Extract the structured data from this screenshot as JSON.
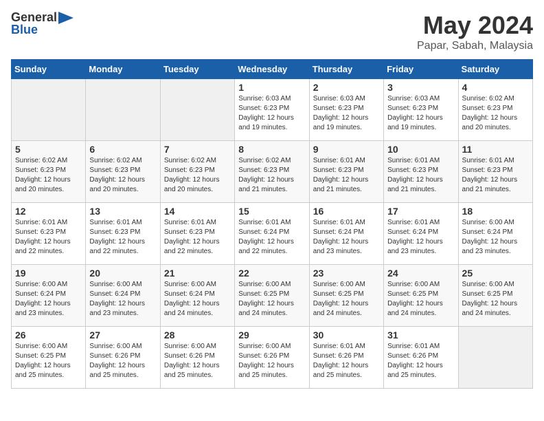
{
  "header": {
    "logo_general": "General",
    "logo_blue": "Blue",
    "month": "May 2024",
    "location": "Papar, Sabah, Malaysia"
  },
  "weekdays": [
    "Sunday",
    "Monday",
    "Tuesday",
    "Wednesday",
    "Thursday",
    "Friday",
    "Saturday"
  ],
  "weeks": [
    [
      {
        "day": "",
        "info": ""
      },
      {
        "day": "",
        "info": ""
      },
      {
        "day": "",
        "info": ""
      },
      {
        "day": "1",
        "info": "Sunrise: 6:03 AM\nSunset: 6:23 PM\nDaylight: 12 hours\nand 19 minutes."
      },
      {
        "day": "2",
        "info": "Sunrise: 6:03 AM\nSunset: 6:23 PM\nDaylight: 12 hours\nand 19 minutes."
      },
      {
        "day": "3",
        "info": "Sunrise: 6:03 AM\nSunset: 6:23 PM\nDaylight: 12 hours\nand 19 minutes."
      },
      {
        "day": "4",
        "info": "Sunrise: 6:02 AM\nSunset: 6:23 PM\nDaylight: 12 hours\nand 20 minutes."
      }
    ],
    [
      {
        "day": "5",
        "info": "Sunrise: 6:02 AM\nSunset: 6:23 PM\nDaylight: 12 hours\nand 20 minutes."
      },
      {
        "day": "6",
        "info": "Sunrise: 6:02 AM\nSunset: 6:23 PM\nDaylight: 12 hours\nand 20 minutes."
      },
      {
        "day": "7",
        "info": "Sunrise: 6:02 AM\nSunset: 6:23 PM\nDaylight: 12 hours\nand 20 minutes."
      },
      {
        "day": "8",
        "info": "Sunrise: 6:02 AM\nSunset: 6:23 PM\nDaylight: 12 hours\nand 21 minutes."
      },
      {
        "day": "9",
        "info": "Sunrise: 6:01 AM\nSunset: 6:23 PM\nDaylight: 12 hours\nand 21 minutes."
      },
      {
        "day": "10",
        "info": "Sunrise: 6:01 AM\nSunset: 6:23 PM\nDaylight: 12 hours\nand 21 minutes."
      },
      {
        "day": "11",
        "info": "Sunrise: 6:01 AM\nSunset: 6:23 PM\nDaylight: 12 hours\nand 21 minutes."
      }
    ],
    [
      {
        "day": "12",
        "info": "Sunrise: 6:01 AM\nSunset: 6:23 PM\nDaylight: 12 hours\nand 22 minutes."
      },
      {
        "day": "13",
        "info": "Sunrise: 6:01 AM\nSunset: 6:23 PM\nDaylight: 12 hours\nand 22 minutes."
      },
      {
        "day": "14",
        "info": "Sunrise: 6:01 AM\nSunset: 6:23 PM\nDaylight: 12 hours\nand 22 minutes."
      },
      {
        "day": "15",
        "info": "Sunrise: 6:01 AM\nSunset: 6:24 PM\nDaylight: 12 hours\nand 22 minutes."
      },
      {
        "day": "16",
        "info": "Sunrise: 6:01 AM\nSunset: 6:24 PM\nDaylight: 12 hours\nand 23 minutes."
      },
      {
        "day": "17",
        "info": "Sunrise: 6:01 AM\nSunset: 6:24 PM\nDaylight: 12 hours\nand 23 minutes."
      },
      {
        "day": "18",
        "info": "Sunrise: 6:00 AM\nSunset: 6:24 PM\nDaylight: 12 hours\nand 23 minutes."
      }
    ],
    [
      {
        "day": "19",
        "info": "Sunrise: 6:00 AM\nSunset: 6:24 PM\nDaylight: 12 hours\nand 23 minutes."
      },
      {
        "day": "20",
        "info": "Sunrise: 6:00 AM\nSunset: 6:24 PM\nDaylight: 12 hours\nand 23 minutes."
      },
      {
        "day": "21",
        "info": "Sunrise: 6:00 AM\nSunset: 6:24 PM\nDaylight: 12 hours\nand 24 minutes."
      },
      {
        "day": "22",
        "info": "Sunrise: 6:00 AM\nSunset: 6:25 PM\nDaylight: 12 hours\nand 24 minutes."
      },
      {
        "day": "23",
        "info": "Sunrise: 6:00 AM\nSunset: 6:25 PM\nDaylight: 12 hours\nand 24 minutes."
      },
      {
        "day": "24",
        "info": "Sunrise: 6:00 AM\nSunset: 6:25 PM\nDaylight: 12 hours\nand 24 minutes."
      },
      {
        "day": "25",
        "info": "Sunrise: 6:00 AM\nSunset: 6:25 PM\nDaylight: 12 hours\nand 24 minutes."
      }
    ],
    [
      {
        "day": "26",
        "info": "Sunrise: 6:00 AM\nSunset: 6:25 PM\nDaylight: 12 hours\nand 25 minutes."
      },
      {
        "day": "27",
        "info": "Sunrise: 6:00 AM\nSunset: 6:26 PM\nDaylight: 12 hours\nand 25 minutes."
      },
      {
        "day": "28",
        "info": "Sunrise: 6:00 AM\nSunset: 6:26 PM\nDaylight: 12 hours\nand 25 minutes."
      },
      {
        "day": "29",
        "info": "Sunrise: 6:00 AM\nSunset: 6:26 PM\nDaylight: 12 hours\nand 25 minutes."
      },
      {
        "day": "30",
        "info": "Sunrise: 6:01 AM\nSunset: 6:26 PM\nDaylight: 12 hours\nand 25 minutes."
      },
      {
        "day": "31",
        "info": "Sunrise: 6:01 AM\nSunset: 6:26 PM\nDaylight: 12 hours\nand 25 minutes."
      },
      {
        "day": "",
        "info": ""
      }
    ]
  ]
}
